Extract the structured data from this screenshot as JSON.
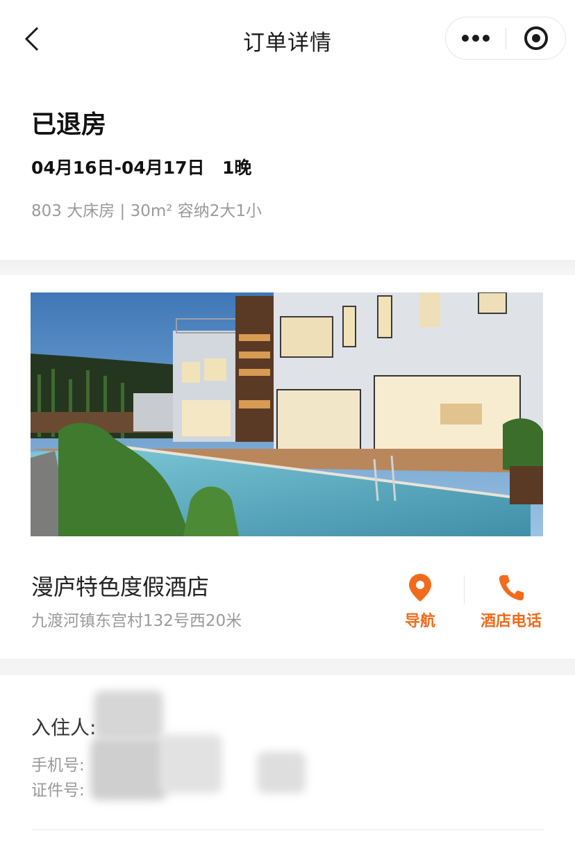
{
  "navbar": {
    "title": "订单详情",
    "back_icon": "chevron-left-icon",
    "more_icon": "more-dots-icon",
    "close_icon": "target-circle-icon"
  },
  "order": {
    "status": "已退房",
    "dates": "04月16日-04月17日",
    "nights": "1晚",
    "room_info": "803 大床房 | 30m² 容纳2大1小"
  },
  "hotel": {
    "name": "漫庐特色度假酒店",
    "address": "九渡河镇东宫村132号西20米",
    "nav_label": "导航",
    "nav_icon": "location-pin-icon",
    "phone_label": "酒店电话",
    "phone_icon": "phone-icon",
    "accent_color": "#f26a1b"
  },
  "guest": {
    "guest_label": "入住人:",
    "phone_label": "手机号:",
    "id_label": "证件号:"
  }
}
